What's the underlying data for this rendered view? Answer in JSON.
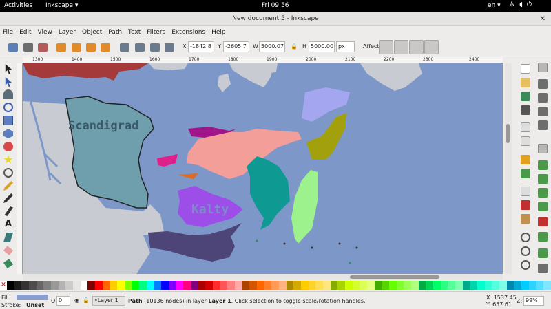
{
  "topbar": {
    "activities": "Activities",
    "app": "Inkscape",
    "app_arrow": "▾",
    "clock": "Fri 09:56",
    "lang": "en",
    "lang_arrow": "▾"
  },
  "window": {
    "title": "New document 5 - Inkscape",
    "close": "✕"
  },
  "menu": [
    "File",
    "Edit",
    "View",
    "Layer",
    "Object",
    "Path",
    "Text",
    "Filters",
    "Extensions",
    "Help"
  ],
  "toolctrl": {
    "x_label": "X",
    "x_value": "-1842.8",
    "y_label": "Y",
    "y_value": "-2605.7",
    "w_label": "W",
    "w_value": "5000.07",
    "h_label": "H",
    "h_value": "5000.00",
    "unit": "px",
    "affect_label": "Affect:"
  },
  "ruler_ticks": [
    "1300",
    "1400",
    "1500",
    "1600",
    "1700",
    "1800",
    "1900",
    "2000",
    "2100",
    "2200",
    "2300",
    "2400"
  ],
  "map": {
    "label_scandigrad": "Scandigrad",
    "label_kalty": "Kalty"
  },
  "colors": {
    "ocean": "#7e97c9",
    "scandigrad": "#6f9fac",
    "land_grey": "#c8ccd2",
    "red": "#a43a3a",
    "magenta": "#a0168a",
    "pink": "#e0208a",
    "salmon": "#f49e9a",
    "teal": "#0e9a93",
    "lightgreen": "#9ef28e",
    "olive": "#a3a00e",
    "lavender": "#a5a6f0",
    "purple": "#9d4de8",
    "navy": "#4d4577",
    "orange": "#e06a20"
  },
  "palette": [
    "#000000",
    "#1a1a1a",
    "#333333",
    "#4d4d4d",
    "#666666",
    "#808080",
    "#999999",
    "#b3b3b3",
    "#cccccc",
    "#e6e6e6",
    "#ffffff",
    "#800000",
    "#ff0000",
    "#ff6600",
    "#ffcc00",
    "#ffff00",
    "#80ff00",
    "#00ff00",
    "#00ff80",
    "#00ffff",
    "#0080ff",
    "#0000ff",
    "#8000ff",
    "#ff00ff",
    "#ff0080",
    "#800080",
    "#aa0000",
    "#d40000",
    "#ff2a2a",
    "#ff5555",
    "#ff8080",
    "#ffaaaa",
    "#aa4400",
    "#d45500",
    "#ff6600",
    "#ff7f2a",
    "#ff9955",
    "#ffb380",
    "#aa8800",
    "#d4aa00",
    "#ffcc00",
    "#ffd42a",
    "#ffdd55",
    "#ffe680",
    "#88aa00",
    "#aad400",
    "#ccff00",
    "#d4ff2a",
    "#ddff55",
    "#e5ff80",
    "#44aa00",
    "#55d400",
    "#66ff00",
    "#7fff2a",
    "#99ff55",
    "#b3ff80",
    "#00aa44",
    "#00d455",
    "#00ff66",
    "#2aff80",
    "#55ff99",
    "#80ffb3",
    "#00aa88",
    "#00d4aa",
    "#00ffcc",
    "#2affd5",
    "#55ffdd",
    "#80ffe6",
    "#0088aa",
    "#00aad4",
    "#00ccff",
    "#2ad4ff",
    "#55ddff",
    "#80e5ff"
  ],
  "status": {
    "fill_label": "Fill:",
    "stroke_label": "Stroke:",
    "stroke_value": "Unset",
    "opacity_label": "O:",
    "opacity_value": "0",
    "layer": "•Layer 1",
    "message_bold": "Path",
    "message": " (10136 nodes) in layer ",
    "message_layer": "Layer 1",
    "message_tail": ". Click selection to toggle scale/rotation handles.",
    "x_coord": "X: 1537.45",
    "y_coord": "Y:   657.61",
    "z_label": "Z:",
    "zoom": "99%"
  }
}
